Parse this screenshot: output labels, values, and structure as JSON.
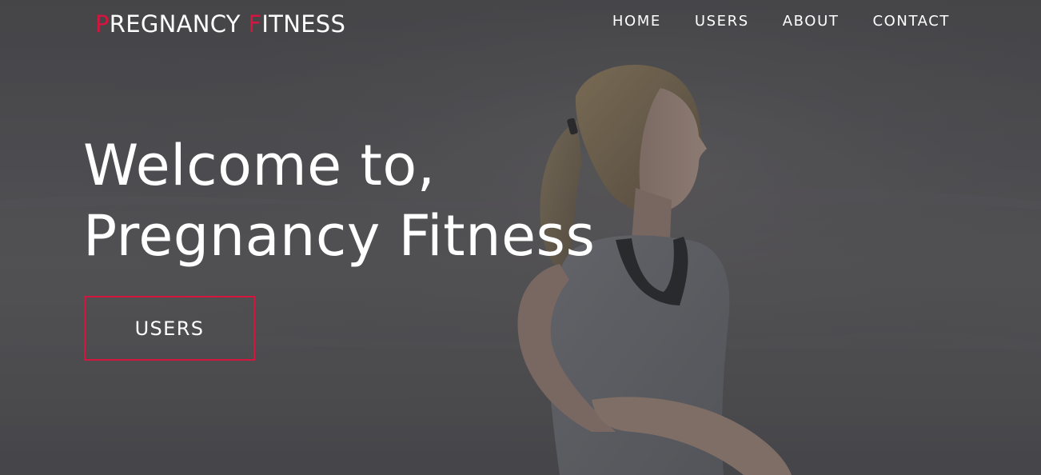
{
  "brand": {
    "logo_first_initial": "P",
    "logo_first_rest": "REGNANCY ",
    "logo_second_initial": "F",
    "logo_second_rest": "ITNESS",
    "accent_color": "#d5143f"
  },
  "nav": {
    "items": [
      {
        "label": "HOME"
      },
      {
        "label": "USERS"
      },
      {
        "label": "ABOUT"
      },
      {
        "label": "CONTACT"
      }
    ]
  },
  "hero": {
    "headline_line1": "Welcome to,",
    "headline_line2": "Pregnancy Fitness",
    "cta_label": "USERS",
    "background_image": "woman-stretching-photo"
  }
}
